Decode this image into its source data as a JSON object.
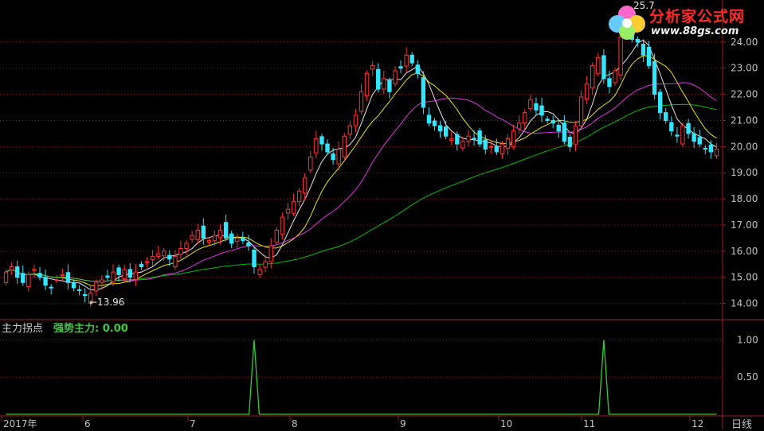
{
  "indicator": {
    "name": "主力拐点",
    "value_text": "强势主力: 0.00",
    "value_color": "#33cc33"
  },
  "period_label": "日线",
  "logo": {
    "title": "分析家公式网",
    "url": "www.88gs.com",
    "icon": "flower-logo-icon"
  },
  "price_annotation": {
    "low_label": "←13.96",
    "top_label_partial": "25.7"
  },
  "colors": {
    "up": "#ff3333",
    "down": "#33e6ff",
    "ma5": "#ffffff",
    "ma10": "#ffff00",
    "ma20": "#ff33ff",
    "ma60": "#00ff00",
    "grid": "#8a1c1c",
    "signal": "#33cc33"
  },
  "chart_data": [
    {
      "type": "candlestick",
      "title": "",
      "x_labels": [
        "2017年",
        "6",
        "7",
        "8",
        "9",
        "10",
        "11",
        "12"
      ],
      "y_ticks": [
        "14.00",
        "15.00",
        "16.00",
        "17.00",
        "18.00",
        "19.00",
        "20.00",
        "21.00",
        "22.00",
        "23.00",
        "24.00"
      ],
      "ylim": [
        13.5,
        25.0
      ],
      "grid": true,
      "low_marker": 13.96,
      "close_series": [
        15.2,
        15.4,
        15.0,
        14.8,
        15.1,
        15.3,
        15.0,
        14.7,
        14.6,
        14.9,
        15.1,
        14.8,
        14.6,
        14.5,
        14.3,
        14.4,
        14.8,
        14.9,
        15.0,
        15.2,
        15.1,
        15.3,
        15.0,
        15.2,
        15.4,
        15.6,
        15.8,
        15.9,
        16.0,
        15.7,
        15.8,
        16.1,
        16.3,
        16.6,
        16.8,
        16.5,
        16.4,
        16.6,
        16.8,
        16.5,
        16.3,
        16.5,
        16.4,
        16.2,
        15.4,
        15.3,
        15.6,
        16.2,
        16.8,
        17.3,
        17.6,
        17.9,
        18.3,
        18.8,
        19.6,
        20.3,
        20.1,
        19.8,
        19.5,
        19.9,
        20.4,
        20.8,
        21.2,
        22.1,
        22.8,
        23.1,
        22.2,
        22.6,
        22.1,
        22.9,
        23.0,
        23.5,
        23.2,
        22.8,
        21.5,
        20.9,
        20.8,
        20.6,
        20.4,
        20.3,
        20.1,
        20.2,
        20.4,
        20.3,
        20.1,
        19.9,
        20.0,
        19.8,
        20.1,
        20.3,
        20.6,
        20.9,
        21.3,
        21.8,
        21.4,
        21.2,
        21.0,
        20.9,
        20.6,
        20.2,
        20.0,
        20.8,
        21.9,
        22.4,
        23.1,
        23.4,
        22.6,
        22.3,
        22.9,
        24.2,
        24.6,
        24.1,
        24.0,
        23.5,
        23.1,
        22.0,
        21.3,
        21.0,
        20.6,
        20.4,
        20.8,
        20.5,
        20.2,
        20.1,
        19.9,
        19.8,
        19.9
      ],
      "ma_periods": [
        5,
        10,
        20,
        60
      ]
    },
    {
      "type": "line",
      "title": "",
      "series": [
        {
          "name": "强势主力",
          "pulses_at": [
            44,
            106
          ],
          "pulse_value": 1.0
        }
      ],
      "y_ticks": [
        "0.50",
        "1.00"
      ],
      "ylim": [
        0,
        1.25
      ],
      "grid": true
    }
  ]
}
